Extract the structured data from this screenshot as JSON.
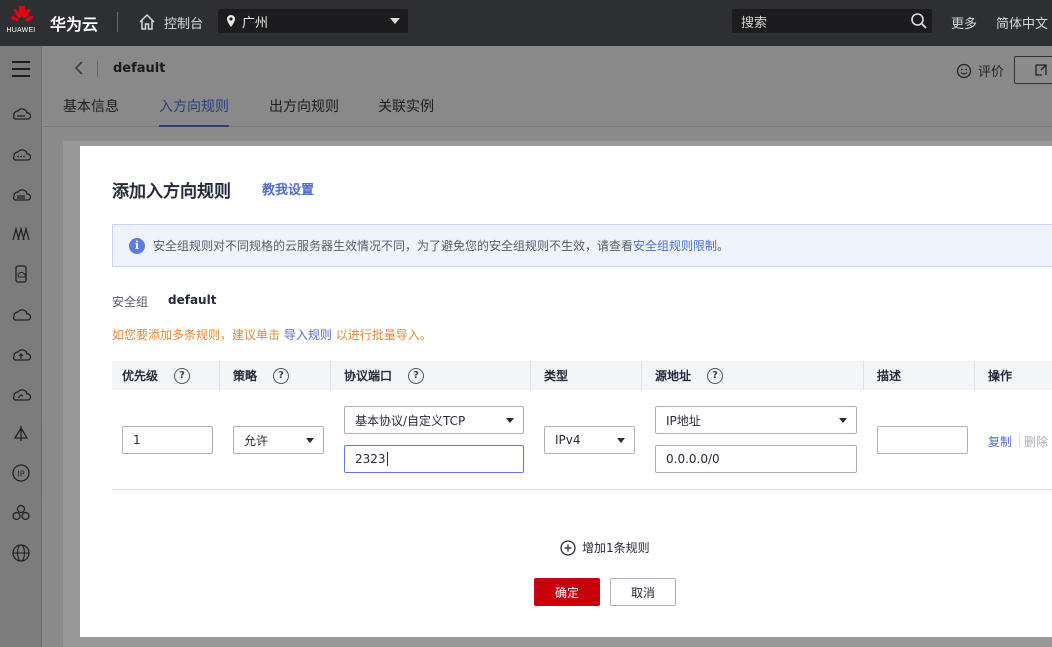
{
  "topbar": {
    "logo_text": "HUAWEI",
    "brand": "华为云",
    "console": "控制台",
    "region": "广州",
    "search_placeholder": "搜索",
    "more": "更多",
    "language": "简体中文"
  },
  "header": {
    "title": "default",
    "rating": "评价"
  },
  "tabs": [
    "基本信息",
    "入方向规则",
    "出方向规则",
    "关联实例"
  ],
  "active_tab": "入方向规则",
  "dialog": {
    "title": "添加入方向规则",
    "help_link": "教我设置",
    "info_text": "安全组规则对不同规格的云服务器生效情况不同，为了避免您的安全组规则不生效，请查看",
    "info_link": "安全组规则限制",
    "info_suffix": "。",
    "security_group_label": "安全组",
    "security_group_value": "default",
    "tip_prefix": "如您要添加多条规则，建议单击",
    "tip_link": "导入规则",
    "tip_suffix": "以进行批量导入。",
    "columns": [
      "优先级",
      "策略",
      "协议端口",
      "类型",
      "源地址",
      "描述",
      "操作"
    ],
    "row": {
      "priority": "1",
      "policy": "允许",
      "protocol": "基本协议/自定义TCP",
      "port": "2323",
      "type": "IPv4",
      "source_type": "IP地址",
      "source_address": "0.0.0.0/0",
      "description": "",
      "copy": "复制",
      "delete": "删除"
    },
    "add_rule": "增加1条规则",
    "ok": "确定",
    "cancel": "取消"
  }
}
